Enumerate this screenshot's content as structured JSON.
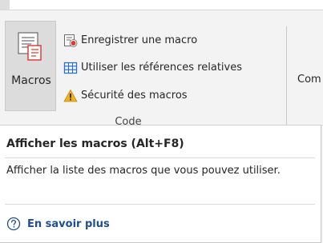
{
  "ribbon": {
    "macros_button": {
      "label": "Macros",
      "icon": "macros-icon"
    },
    "commands": [
      {
        "label": "Enregistrer une macro",
        "icon": "record-macro-icon"
      },
      {
        "label": "Utiliser les références relatives",
        "icon": "relative-references-icon"
      },
      {
        "label": "Sécurité des macros",
        "icon": "warning-icon"
      }
    ],
    "group_label": "Code",
    "next_group_partial": "Com"
  },
  "tooltip": {
    "title": "Afficher les macros (Alt+F8)",
    "description": "Afficher la liste des macros que vous pouvez utiliser.",
    "help_link": "En savoir plus",
    "help_icon": "help-circle-icon"
  },
  "colors": {
    "ribbon_bg": "#f3f3f3",
    "pressed_bg": "#dcdcdc",
    "tooltip_bg": "#ffffff",
    "link": "#1e4e8c",
    "warning": "#f2b01e",
    "record_red": "#e03a2f",
    "grid_blue": "#2a6fc9"
  }
}
